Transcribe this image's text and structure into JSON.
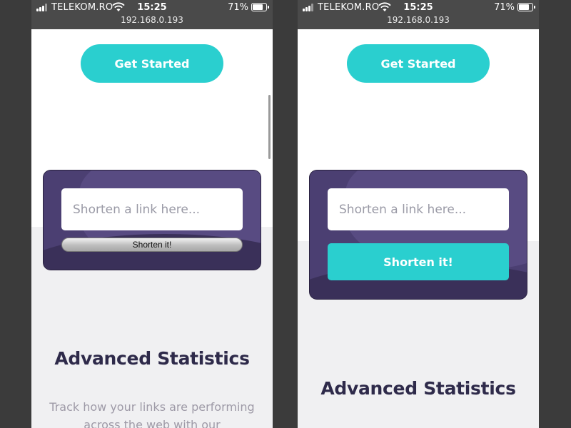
{
  "status_bar": {
    "carrier": "TELEKOM.RO",
    "time": "15:25",
    "battery": "71%",
    "battery_level": 0.71,
    "url": "192.168.0.193"
  },
  "cta": {
    "get_started": "Get Started"
  },
  "shortener": {
    "placeholder": "Shorten a link here...",
    "button": "Shorten it!"
  },
  "stats": {
    "heading": "Advanced Statistics",
    "description": "Track how your links are performing across the web with our"
  },
  "colors": {
    "cyan": "#2acfcf",
    "dark_violet": "#4b3f72",
    "heading": "#2e2a4a",
    "gray_text": "#9e9aa7"
  }
}
